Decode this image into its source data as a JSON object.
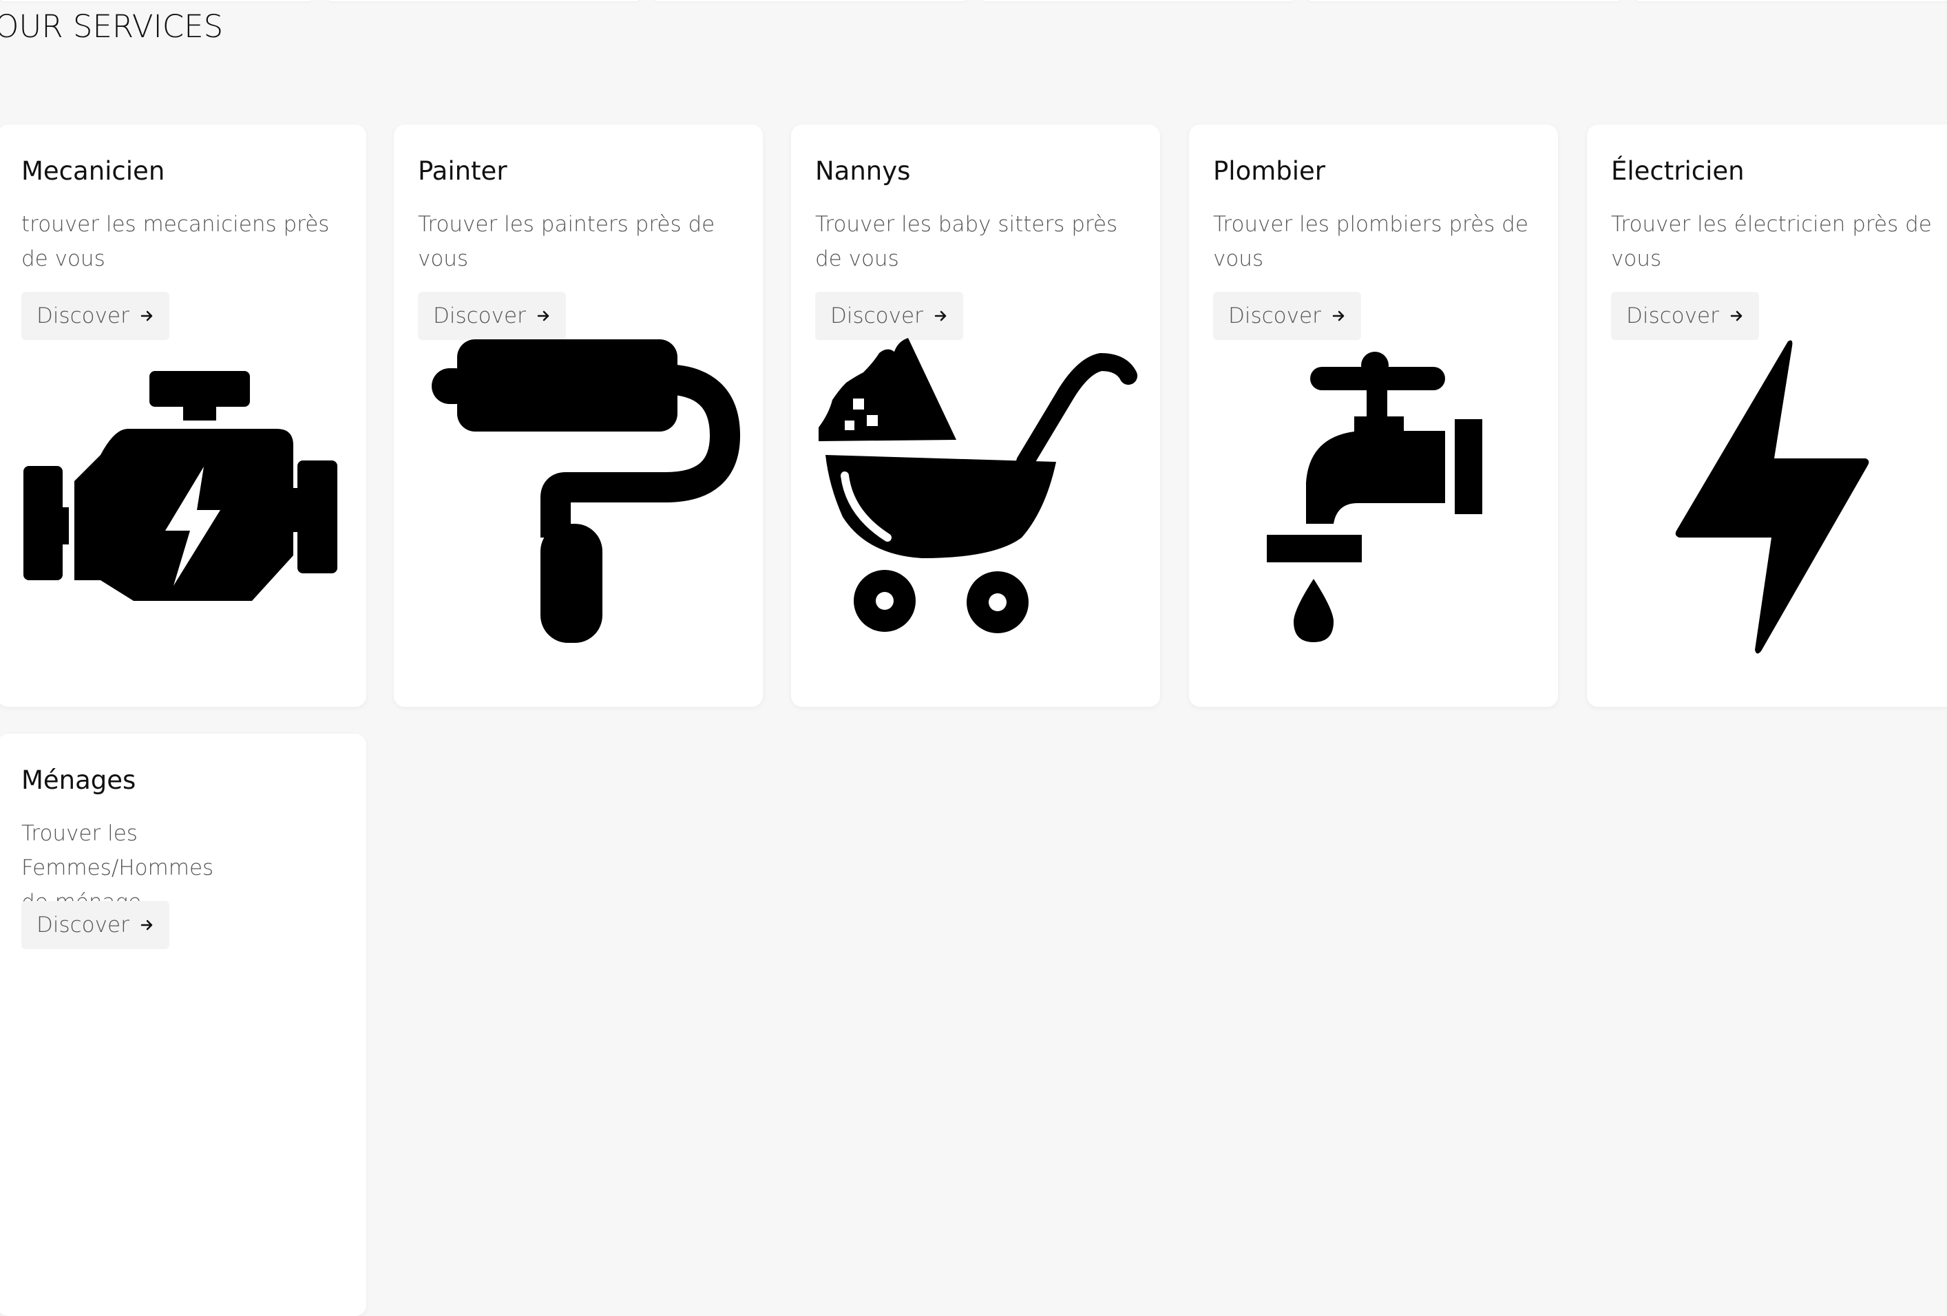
{
  "section": {
    "title": "OUR SERVICES"
  },
  "services": [
    {
      "title": "Mecanicien",
      "description": "trouver les mecaniciens près de vous",
      "button_label": "Discover",
      "icon": "engine-icon"
    },
    {
      "title": "Painter",
      "description": "Trouver les painters près de vous",
      "button_label": "Discover",
      "icon": "paint-roller-icon"
    },
    {
      "title": "Nannys",
      "description": "Trouver les baby sitters près de vous",
      "button_label": "Discover",
      "icon": "baby-carriage-icon"
    },
    {
      "title": "Plombier",
      "description": "Trouver les plombiers près de vous",
      "button_label": "Discover",
      "icon": "faucet-icon"
    },
    {
      "title": "Électricien",
      "description": "Trouver les électricien près de vous",
      "button_label": "Discover",
      "icon": "lightning-bolt-icon"
    },
    {
      "title": "Ménages",
      "description": "Trouver les Femmes/Hommes de ménage",
      "button_label": "Discover",
      "icon": "cleaning-icon"
    }
  ],
  "colors": {
    "background": "#f7f7f7",
    "card": "#ffffff",
    "button": "#f3f3f3",
    "text": "#111111",
    "muted_text": "#555555"
  }
}
